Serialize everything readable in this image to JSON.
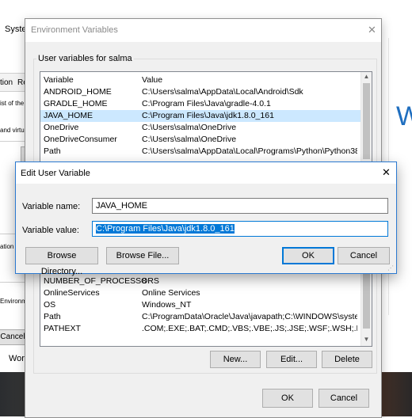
{
  "background": {
    "title_fragment": "Syster",
    "tab_fragment_1": "tion",
    "tab_fragment_2": "Re",
    "text_fragment_1": "ist of the s",
    "text_fragment_2": "and virtu",
    "text_fragment_3": "ation",
    "text_fragment_4": "Environm",
    "cancel_fragment": "Cancel",
    "work_fragment": "Work",
    "right_big_letter": "W"
  },
  "env_dialog": {
    "title": "Environment Variables",
    "user_group_label": "User variables for salma",
    "columns": {
      "variable": "Variable",
      "value": "Value"
    },
    "user_vars": [
      {
        "name": "ANDROID_HOME",
        "value": "C:\\Users\\salma\\AppData\\Local\\Android\\Sdk"
      },
      {
        "name": "GRADLE_HOME",
        "value": "C:\\Program Files\\Java\\gradle-4.0.1"
      },
      {
        "name": "JAVA_HOME",
        "value": "C:\\Program Files\\Java\\jdk1.8.0_161"
      },
      {
        "name": "OneDrive",
        "value": "C:\\Users\\salma\\OneDrive"
      },
      {
        "name": "OneDriveConsumer",
        "value": "C:\\Users\\salma\\OneDrive"
      },
      {
        "name": "Path",
        "value": "C:\\Users\\salma\\AppData\\Local\\Programs\\Python\\Python38\\S..."
      }
    ],
    "system_vars": [
      {
        "name": "NUMBER_OF_PROCESSORS",
        "value": "8"
      },
      {
        "name": "OnlineServices",
        "value": "Online Services"
      },
      {
        "name": "OS",
        "value": "Windows_NT"
      },
      {
        "name": "Path",
        "value": "C:\\ProgramData\\Oracle\\Java\\javapath;C:\\WINDOWS\\system3..."
      },
      {
        "name": "PATHEXT",
        "value": ".COM;.EXE;.BAT;.CMD;.VBS;.VBE;.JS;.JSE;.WSF;.WSH;.MSC"
      }
    ],
    "buttons": {
      "new": "New...",
      "edit": "Edit...",
      "delete": "Delete",
      "ok": "OK",
      "cancel": "Cancel"
    }
  },
  "edit_dialog": {
    "title": "Edit User Variable",
    "name_label": "Variable name:",
    "name_value": "JAVA_HOME",
    "value_label": "Variable value:",
    "value_value": "C:\\Program Files\\Java\\jdk1.8.0_161",
    "buttons": {
      "browse_directory": "Browse Directory...",
      "browse_file": "Browse File...",
      "ok": "OK",
      "cancel": "Cancel"
    }
  },
  "colors": {
    "accent": "#0078d7",
    "selection": "#cce8ff",
    "button_face": "#e1e1e1"
  }
}
